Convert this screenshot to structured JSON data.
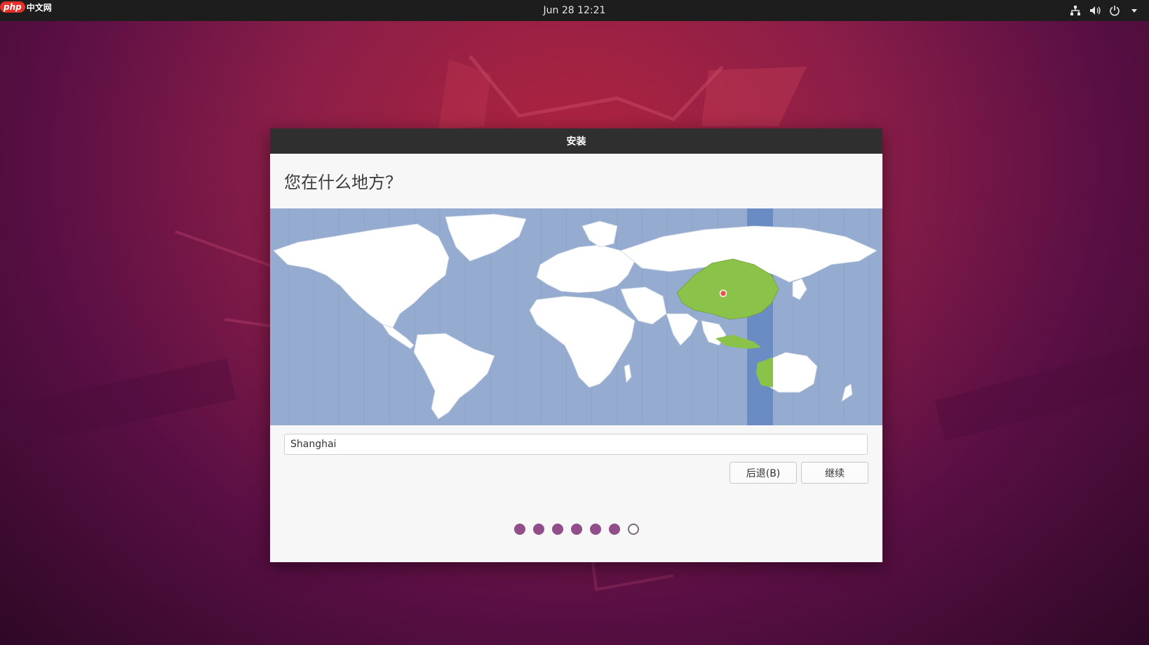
{
  "topbar": {
    "clock": "Jun 28  12:21",
    "tray_icons": [
      "network-icon",
      "volume-icon",
      "power-icon",
      "menu-arrow-icon"
    ]
  },
  "watermark": {
    "badge": "php",
    "text": "中文网"
  },
  "dialog": {
    "title": "安装",
    "heading": "您在什么地方？",
    "map": {
      "selected_timezone": "Shanghai",
      "highlight_color": "#8bc34a",
      "ocean_color": "#95abcf",
      "band_color": "#6a8cc4"
    },
    "location_input": {
      "value": "Shanghai"
    },
    "buttons": {
      "back": "后退(B)",
      "continue": "继续"
    },
    "progress": {
      "total": 7,
      "current": 6
    }
  }
}
